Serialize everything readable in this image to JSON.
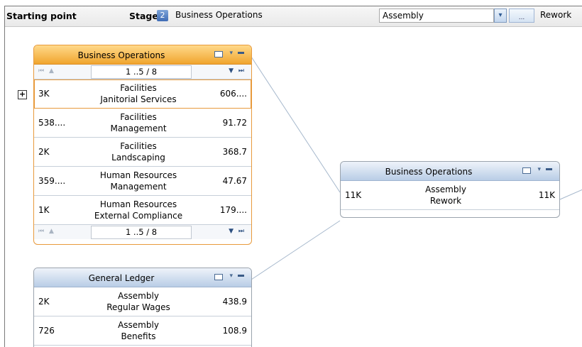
{
  "toolbar": {
    "starting_point_label": "Starting point",
    "stage_label": "Stage",
    "stage_number": "2",
    "stage_value": "Business Operations",
    "assembly_value": "Assembly",
    "dropdown_icon": "▾",
    "ellipsis": "...",
    "rework_value": "Rework"
  },
  "nodes": {
    "business_operations_left": {
      "title": "Business Operations",
      "pager": "1 ..5 / 8",
      "rows": [
        {
          "left": "3K",
          "line1": "Facilities",
          "line2": "Janitorial Services",
          "right": "606...."
        },
        {
          "left": "538....",
          "line1": "Facilities",
          "line2": "Management",
          "right": "91.72"
        },
        {
          "left": "2K",
          "line1": "Facilities",
          "line2": "Landscaping",
          "right": "368.7"
        },
        {
          "left": "359....",
          "line1": "Human Resources",
          "line2": "Management",
          "right": "47.67"
        },
        {
          "left": "1K",
          "line1": "Human Resources",
          "line2": "External Compliance",
          "right": "179...."
        }
      ]
    },
    "general_ledger": {
      "title": "General Ledger",
      "rows": [
        {
          "left": "2K",
          "line1": "Assembly",
          "line2": "Regular Wages",
          "right": "438.9"
        },
        {
          "left": "726",
          "line1": "Assembly",
          "line2": "Benefits",
          "right": "108.9"
        }
      ]
    },
    "business_operations_mid": {
      "title": "Business Operations",
      "rows": [
        {
          "left": "11K",
          "line1": "Assembly",
          "line2": "Rework",
          "right": "11K"
        }
      ]
    }
  },
  "icons": {
    "expand": "+",
    "pager_first_prev": "⏮ ▲",
    "pager_next_last": "▼ ⏭"
  }
}
